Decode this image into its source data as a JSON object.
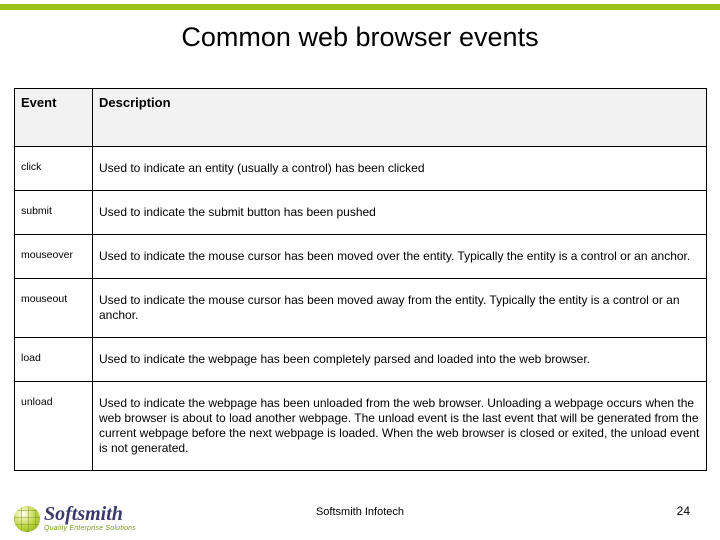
{
  "title": "Common web browser events",
  "headers": {
    "event": "Event",
    "description": "Description"
  },
  "rows": [
    {
      "event": "click",
      "description": "Used to indicate an entity (usually a control) has been clicked"
    },
    {
      "event": "submit",
      "description": "Used to indicate the submit button has been pushed"
    },
    {
      "event": "mouseover",
      "description": "Used to indicate the mouse cursor has been moved over the entity. Typically the entity is a control or an anchor."
    },
    {
      "event": "mouseout",
      "description": "Used to indicate the mouse cursor has been moved away from the entity. Typically the entity is a control or an anchor."
    },
    {
      "event": "load",
      "description": "Used to indicate the webpage has been completely parsed and loaded into the web browser."
    },
    {
      "event": "unload",
      "description": "Used to indicate the webpage has been unloaded from the web browser. Unloading a webpage occurs when the web browser is about to load another webpage. The unload event is the last event that will be generated from the current webpage before the next webpage is loaded. When the web browser is closed or exited, the unload event is not generated."
    }
  ],
  "footer": {
    "center": "Softsmith Infotech",
    "page": "24"
  },
  "logo": {
    "main": "Softsmith",
    "sub": "Quality Enterprise Solutions"
  }
}
